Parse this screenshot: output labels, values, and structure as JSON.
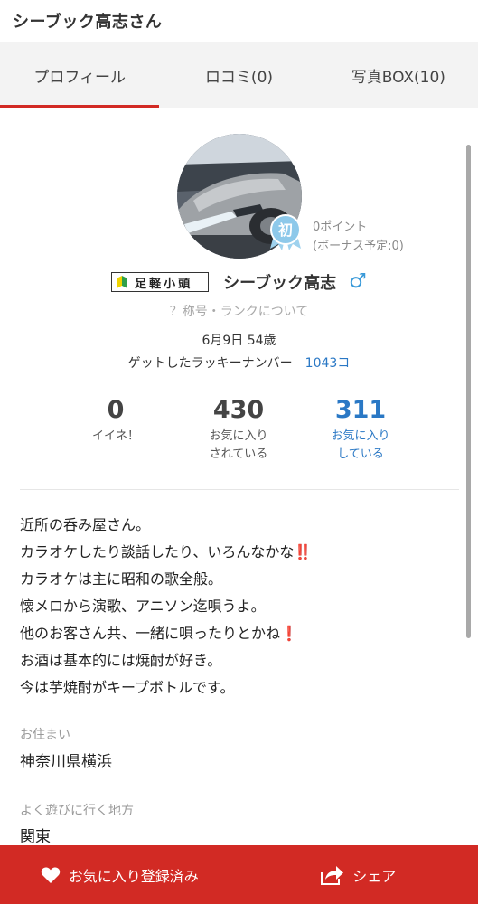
{
  "header": {
    "title": "シーブック高志さん"
  },
  "tabs": [
    {
      "label": "プロフィール",
      "active": true
    },
    {
      "label": "ロコミ(0)",
      "active": false
    },
    {
      "label": "写真BOX(10)",
      "active": false
    }
  ],
  "profile": {
    "rank_badge": "初",
    "points": "0ポイント",
    "bonus": "(ボーナス予定:0)",
    "title_plate": "足軽小頭",
    "name": "シーブック高志",
    "gender_symbol": "♂",
    "rank_link": "？称号・ランクについて",
    "birth_age": "6月9日 54歳",
    "lucky_label": "ゲットしたラッキーナンバー",
    "lucky_number": "1043コ"
  },
  "stats": [
    {
      "value": "0",
      "label1": "イイネ！",
      "label2": ""
    },
    {
      "value": "430",
      "label1": "お気に入り",
      "label2": "されている"
    },
    {
      "value": "311",
      "label1": "お気に入り",
      "label2": "している"
    }
  ],
  "bio": [
    {
      "text": "近所の呑み屋さん。",
      "emoji": ""
    },
    {
      "text": "カラオケしたり談話したり、いろんなかな",
      "emoji": "‼️"
    },
    {
      "text": "カラオケは主に昭和の歌全般。",
      "emoji": ""
    },
    {
      "text": "懐メロから演歌、アニソン迄唄うよ。",
      "emoji": ""
    },
    {
      "text": "他のお客さん共、一緒に唄ったりとかね",
      "emoji": "❗"
    },
    {
      "text": "お酒は基本的には焼酎が好き。",
      "emoji": ""
    },
    {
      "text": "今は芋焼酎がキープボトルです。",
      "emoji": ""
    }
  ],
  "residence": {
    "label": "お住まい",
    "value": "神奈川県横浜"
  },
  "area": {
    "label": "よく遊びに行く地方",
    "value": "関東"
  },
  "bottom_bar": {
    "favorite_label": "お気に入り登録済み",
    "share_label": "シェア"
  },
  "colors": {
    "accent": "#d22a24",
    "link_blue": "#2a78c5",
    "male_blue": "#3a9ad9"
  }
}
